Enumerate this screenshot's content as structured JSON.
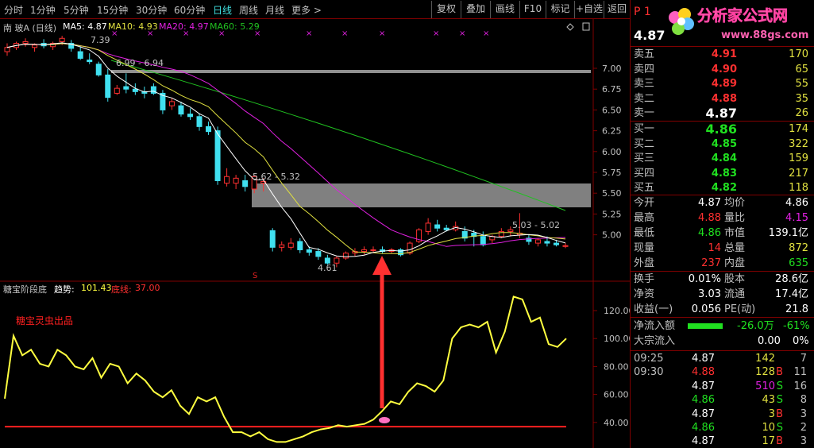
{
  "toolbar": {
    "periods": [
      "分时",
      "1分钟",
      "5分钟",
      "15分钟",
      "30分钟",
      "60分钟",
      "日线",
      "周线",
      "月线",
      "更多 >"
    ],
    "active_period": "日线",
    "buttons": [
      "复权",
      "叠加",
      "画线",
      "F10",
      "标记",
      "+自选",
      "返回"
    ]
  },
  "stock_header": {
    "title": "南 玻A (日线)",
    "ma5": "MA5: 4.87",
    "ma10": "MA10: 4.93",
    "ma20": "MA20: 4.97",
    "ma60": "MA60: 5.29"
  },
  "price_axis": [
    "7.00",
    "6.75",
    "6.50",
    "6.25",
    "6.00",
    "5.75",
    "5.50",
    "5.25",
    "5.00"
  ],
  "price_annotations": {
    "high_label": "7.39",
    "range1": "6.99 - 6.94",
    "range2": "5.62 - 5.32",
    "range3": "5.03 - 5.02",
    "low_label": "4.61",
    "marker_s": "S"
  },
  "indicator_header": {
    "name": "糖宝阶段底",
    "trend_label": "趋势: ",
    "trend_value": "101.43",
    "bottom_label": "底线: ",
    "bottom_value": "37.00"
  },
  "indicator_axis": [
    "120.00",
    "100.00",
    "80.00",
    "60.00",
    "40.00"
  ],
  "indicator_watermark": "糖宝灵虫出品",
  "chart_data": {
    "type": "line",
    "title": "",
    "ylim": [
      20,
      135
    ],
    "series": [
      {
        "name": "趋势",
        "values": [
          57,
          102,
          88,
          92,
          82,
          80,
          92,
          88,
          80,
          78,
          86,
          72,
          82,
          80,
          68,
          75,
          70,
          62,
          58,
          63,
          52,
          46,
          58,
          55,
          58,
          44,
          33,
          33,
          30,
          33,
          28,
          26,
          26,
          28,
          30,
          33,
          35,
          36,
          38,
          37,
          38,
          39,
          42,
          48,
          55,
          53,
          62,
          68,
          66,
          62,
          70,
          100,
          108,
          110,
          108,
          112,
          90,
          105,
          130,
          128,
          112,
          115,
          96,
          94,
          100
        ]
      },
      {
        "name": "底线",
        "values": [
          37,
          37,
          37,
          37,
          37,
          37,
          37,
          37,
          37,
          37,
          37,
          37,
          37,
          37,
          37,
          37,
          37,
          37,
          37,
          37,
          37,
          37,
          37,
          37,
          37,
          37,
          37,
          37,
          37,
          37,
          37,
          37,
          37,
          37,
          37,
          37,
          37,
          37,
          37,
          37,
          37,
          37,
          37,
          37,
          37,
          37,
          37,
          37,
          37,
          37,
          37,
          37,
          37,
          37,
          37,
          37,
          37,
          37,
          37,
          37,
          37,
          37,
          37,
          37,
          37
        ]
      }
    ],
    "price_ylim": [
      4.5,
      7.5
    ],
    "ohlc": [
      [
        7.2,
        7.3,
        7.15,
        7.25
      ],
      [
        7.25,
        7.32,
        7.22,
        7.3
      ],
      [
        7.3,
        7.36,
        7.26,
        7.32
      ],
      [
        7.25,
        7.3,
        7.2,
        7.28
      ],
      [
        7.3,
        7.35,
        7.24,
        7.27
      ],
      [
        7.26,
        7.32,
        7.22,
        7.3
      ],
      [
        7.32,
        7.39,
        7.28,
        7.36
      ],
      [
        7.3,
        7.34,
        7.2,
        7.24
      ],
      [
        7.2,
        7.26,
        7.1,
        7.12
      ],
      [
        7.1,
        7.18,
        7.05,
        7.08
      ],
      [
        7.05,
        7.08,
        6.9,
        6.92
      ],
      [
        6.92,
        6.99,
        6.6,
        6.65
      ],
      [
        6.7,
        6.8,
        6.68,
        6.76
      ],
      [
        6.78,
        6.94,
        6.7,
        6.75
      ],
      [
        6.75,
        6.82,
        6.68,
        6.72
      ],
      [
        6.72,
        6.78,
        6.64,
        6.7
      ],
      [
        6.78,
        6.82,
        6.68,
        6.7
      ],
      [
        6.7,
        6.74,
        6.45,
        6.5
      ],
      [
        6.55,
        6.64,
        6.5,
        6.6
      ],
      [
        6.55,
        6.6,
        6.42,
        6.45
      ],
      [
        6.45,
        6.52,
        6.38,
        6.42
      ],
      [
        6.42,
        6.46,
        6.25,
        6.3
      ],
      [
        6.3,
        6.36,
        6.2,
        6.24
      ],
      [
        6.25,
        6.3,
        5.6,
        5.65
      ],
      [
        5.62,
        5.8,
        5.58,
        5.7
      ],
      [
        5.62,
        5.72,
        5.55,
        5.68
      ],
      [
        5.65,
        5.72,
        5.52,
        5.58
      ],
      [
        5.55,
        5.72,
        5.5,
        5.7
      ],
      [
        5.62,
        5.68,
        5.52,
        5.64
      ],
      [
        5.05,
        5.08,
        4.8,
        4.85
      ],
      [
        4.85,
        4.92,
        4.8,
        4.88
      ],
      [
        4.85,
        4.96,
        4.82,
        4.9
      ],
      [
        4.92,
        4.96,
        4.78,
        4.82
      ],
      [
        4.82,
        4.86,
        4.75,
        4.79
      ],
      [
        4.8,
        4.84,
        4.7,
        4.74
      ],
      [
        4.72,
        4.76,
        4.64,
        4.66
      ],
      [
        4.66,
        4.74,
        4.61,
        4.72
      ],
      [
        4.72,
        4.8,
        4.7,
        4.78
      ],
      [
        4.78,
        4.84,
        4.74,
        4.8
      ],
      [
        4.8,
        4.86,
        4.76,
        4.82
      ],
      [
        4.82,
        4.86,
        4.78,
        4.82
      ],
      [
        4.82,
        4.86,
        4.78,
        4.8
      ],
      [
        4.8,
        4.84,
        4.78,
        4.82
      ],
      [
        4.82,
        4.84,
        4.74,
        4.76
      ],
      [
        4.78,
        4.92,
        4.76,
        4.9
      ],
      [
        4.92,
        5.08,
        4.9,
        5.06
      ],
      [
        5.04,
        5.2,
        5.0,
        5.14
      ],
      [
        5.12,
        5.18,
        5.04,
        5.08
      ],
      [
        5.08,
        5.12,
        5.04,
        5.06
      ],
      [
        5.06,
        5.16,
        5.04,
        5.1
      ],
      [
        5.04,
        5.1,
        4.92,
        4.96
      ],
      [
        5.02,
        5.06,
        4.86,
        4.98
      ],
      [
        4.98,
        5.04,
        4.86,
        4.88
      ],
      [
        4.94,
        5.0,
        4.9,
        4.98
      ],
      [
        4.98,
        5.08,
        4.96,
        5.04
      ],
      [
        5.04,
        5.1,
        4.98,
        5.06
      ],
      [
        5.0,
        5.26,
        4.96,
        5.02
      ],
      [
        4.96,
        5.0,
        4.88,
        4.92
      ],
      [
        4.9,
        4.96,
        4.86,
        4.94
      ],
      [
        4.92,
        4.98,
        4.86,
        4.9
      ],
      [
        4.9,
        4.94,
        4.86,
        4.88
      ],
      [
        4.86,
        4.9,
        4.84,
        4.87
      ]
    ]
  },
  "quote": {
    "code": "P 1",
    "price": "4.87",
    "sell": [
      {
        "label": "卖五",
        "price": "4.91",
        "vol": "170"
      },
      {
        "label": "卖四",
        "price": "4.90",
        "vol": "65"
      },
      {
        "label": "卖三",
        "price": "4.89",
        "vol": "55"
      },
      {
        "label": "卖二",
        "price": "4.88",
        "vol": "35"
      },
      {
        "label": "卖一",
        "price": "4.87",
        "vol": "26"
      }
    ],
    "buy": [
      {
        "label": "买一",
        "price": "4.86",
        "vol": "174"
      },
      {
        "label": "买二",
        "price": "4.85",
        "vol": "322"
      },
      {
        "label": "买三",
        "price": "4.84",
        "vol": "159"
      },
      {
        "label": "买四",
        "price": "4.83",
        "vol": "217"
      },
      {
        "label": "买五",
        "price": "4.82",
        "vol": "118"
      }
    ],
    "stats": [
      {
        "l1": "今开",
        "v1": "4.87",
        "l2": "均价",
        "v2": "4.86"
      },
      {
        "l1": "最高",
        "v1": "4.88",
        "l2": "量比",
        "v2": "4.15"
      },
      {
        "l1": "最低",
        "v1": "4.86",
        "l2": "市值",
        "v2": "139.1亿"
      },
      {
        "l1": "现量",
        "v1": "14",
        "l2": "总量",
        "v2": "872"
      },
      {
        "l1": "外盘",
        "v1": "237",
        "l2": "内盘",
        "v2": "635"
      }
    ],
    "stats2": [
      {
        "l1": "换手",
        "v1": "0.01%",
        "l2": "股本",
        "v2": "28.6亿"
      },
      {
        "l1": "净资",
        "v1": "3.03",
        "l2": "流通",
        "v2": "17.4亿"
      },
      {
        "l1": "收益(一)",
        "v1": "0.056",
        "l2": "PE(动)",
        "v2": "21.8"
      }
    ],
    "inflow_label": "净流入额",
    "inflow_value": "-26.0万",
    "inflow_pct": "-61%",
    "big_label": "大宗流入",
    "big_value": "0.00",
    "big_pct": "0%",
    "ticks": [
      {
        "t": "09:25",
        "p": "4.87",
        "v": "142",
        "d": "",
        "n": "7"
      },
      {
        "t": "09:30",
        "p": "4.88",
        "v": "128",
        "d": "B",
        "n": "11"
      },
      {
        "t": "",
        "p": "4.87",
        "v": "510",
        "d": "S",
        "n": "16"
      },
      {
        "t": "",
        "p": "4.86",
        "v": "43",
        "d": "S",
        "n": "8"
      },
      {
        "t": "",
        "p": "4.87",
        "v": "3",
        "d": "B",
        "n": "3"
      },
      {
        "t": "",
        "p": "4.86",
        "v": "10",
        "d": "S",
        "n": "2"
      },
      {
        "t": "",
        "p": "4.87",
        "v": "17",
        "d": "B",
        "n": "3"
      }
    ]
  },
  "logo": {
    "text": "分析家公式网",
    "url": "www.88gs.com"
  }
}
